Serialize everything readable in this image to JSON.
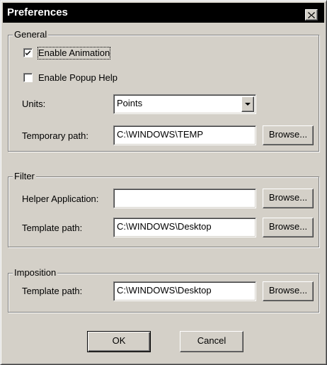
{
  "window": {
    "title": "Preferences",
    "close_icon": "close-icon"
  },
  "general": {
    "legend": "General",
    "enable_animation": {
      "label": "Enable Animation",
      "checked": true
    },
    "enable_popup_help": {
      "label": "Enable Popup Help",
      "checked": false
    },
    "units": {
      "label": "Units:",
      "value": "Points"
    },
    "temporary_path": {
      "label": "Temporary path:",
      "value": "C:\\WINDOWS\\TEMP",
      "browse_label": "Browse..."
    }
  },
  "filter": {
    "legend": "Filter",
    "helper_application": {
      "label": "Helper Application:",
      "value": "",
      "browse_label": "Browse..."
    },
    "template_path": {
      "label": "Template path:",
      "value": "C:\\WINDOWS\\Desktop",
      "browse_label": "Browse..."
    }
  },
  "imposition": {
    "legend": "Imposition",
    "template_path": {
      "label": "Template path:",
      "value": "C:\\WINDOWS\\Desktop",
      "browse_label": "Browse..."
    }
  },
  "footer": {
    "ok_label": "OK",
    "cancel_label": "Cancel"
  }
}
